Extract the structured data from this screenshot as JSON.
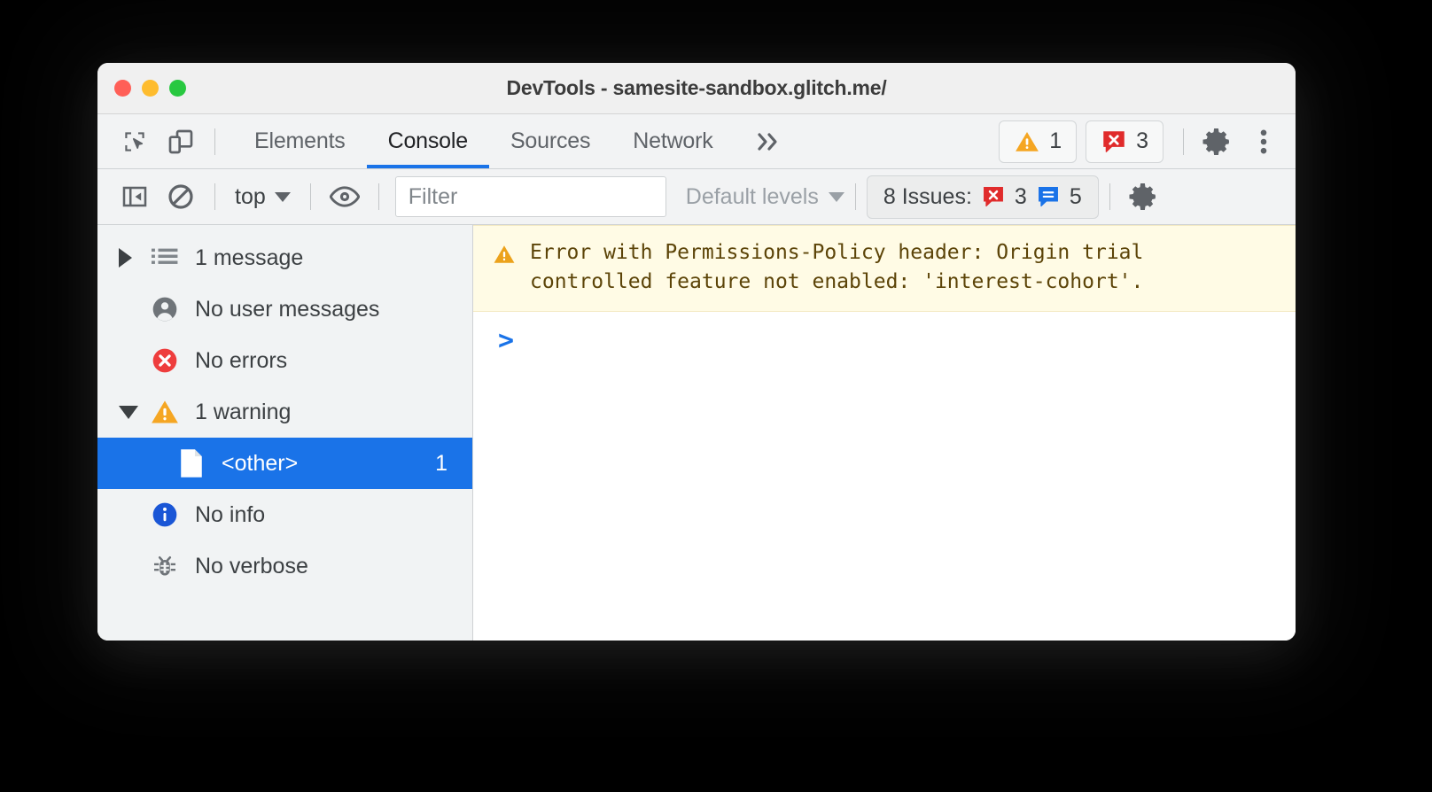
{
  "window": {
    "title": "DevTools - samesite-sandbox.glitch.me/",
    "traffic_lights": [
      "close",
      "minimize",
      "maximize"
    ]
  },
  "tabbar": {
    "inspect_icon": "inspect-element-icon",
    "device_icon": "device-toolbar-icon",
    "tabs": [
      {
        "label": "Elements",
        "active": false
      },
      {
        "label": "Console",
        "active": true
      },
      {
        "label": "Sources",
        "active": false
      },
      {
        "label": "Network",
        "active": false
      }
    ],
    "more_tabs_label": "»",
    "warning_count": "1",
    "error_count": "3",
    "settings_icon": "gear-icon",
    "menu_icon": "more-vertical-icon"
  },
  "filterbar": {
    "sidebar_toggle_icon": "console-sidebar-icon",
    "clear_icon": "clear-console-icon",
    "context_label": "top",
    "eye_icon": "live-expression-icon",
    "filter_placeholder": "Filter",
    "filter_value": "",
    "levels_label": "Default levels",
    "issues_label": "8 Issues:",
    "issues_error_count": "3",
    "issues_info_count": "5",
    "settings_icon": "gear-icon"
  },
  "sidebar": {
    "rows": [
      {
        "label": "1 message",
        "icon": "list-icon",
        "twisty": "collapsed",
        "count": "",
        "selected": false
      },
      {
        "label": "No user messages",
        "icon": "user-icon",
        "twisty": "none",
        "count": "",
        "selected": false
      },
      {
        "label": "No errors",
        "icon": "error-icon",
        "twisty": "none",
        "count": "",
        "selected": false
      },
      {
        "label": "1 warning",
        "icon": "warning-icon",
        "twisty": "expanded",
        "count": "",
        "selected": false
      },
      {
        "label": "<other>",
        "icon": "file-icon",
        "twisty": "none",
        "count": "1",
        "selected": true
      },
      {
        "label": "No info",
        "icon": "info-icon",
        "twisty": "none",
        "count": "",
        "selected": false
      },
      {
        "label": "No verbose",
        "icon": "bug-icon",
        "twisty": "none",
        "count": "",
        "selected": false
      }
    ]
  },
  "console": {
    "message": {
      "icon": "warning-icon",
      "text": "Error with Permissions-Policy header: Origin trial\ncontrolled feature not enabled: 'interest-cohort'."
    },
    "prompt_caret": ">"
  },
  "colors": {
    "accent_blue": "#1a73e8",
    "warning_yellow": "#f5a623",
    "error_red": "#ee3d3d",
    "warn_bg": "#fffbe5",
    "warn_text": "#5c4408",
    "sidebar_bg": "#f1f3f4",
    "toolbar_bg": "#f2f3f4"
  }
}
